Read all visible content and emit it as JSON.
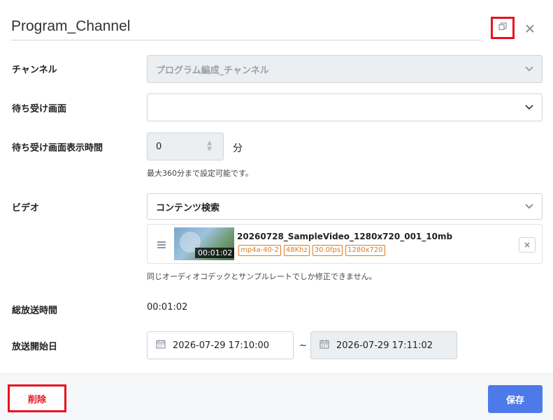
{
  "header": {
    "title": "Program_Channel",
    "copy_icon": "window-restore-icon",
    "close_icon": "close-icon"
  },
  "channel": {
    "label": "チャンネル",
    "value": "プログラム編成_チャンネル"
  },
  "standby_screen": {
    "label": "待ち受け画面",
    "value": ""
  },
  "standby_duration": {
    "label": "待ち受け画面表示時間",
    "value": "0",
    "unit": "分",
    "hint": "最大360分まで設定可能です。"
  },
  "video": {
    "label": "ビデオ",
    "search_label": "コンテンツ検索",
    "item": {
      "name": "20260728_SampleVideo_1280x720_001_10mb",
      "duration": "00:01:02",
      "tags": [
        "mp4a-40-2",
        "48Khz",
        "30.0fps",
        "1280x720"
      ]
    },
    "hint": "同じオーディオコデックとサンプルレートでしか修正できません。"
  },
  "total_duration": {
    "label": "総放送時間",
    "value": "00:01:02"
  },
  "broadcast_start": {
    "label": "放送開始日",
    "start": "2026-07-29 17:10:00",
    "separator": "~",
    "end": "2026-07-29 17:11:02"
  },
  "footer": {
    "delete_label": "削除",
    "save_label": "保存"
  },
  "colors": {
    "accent": "#4d7ae8",
    "danger": "#e8121f",
    "tag": "#e07a1f"
  }
}
